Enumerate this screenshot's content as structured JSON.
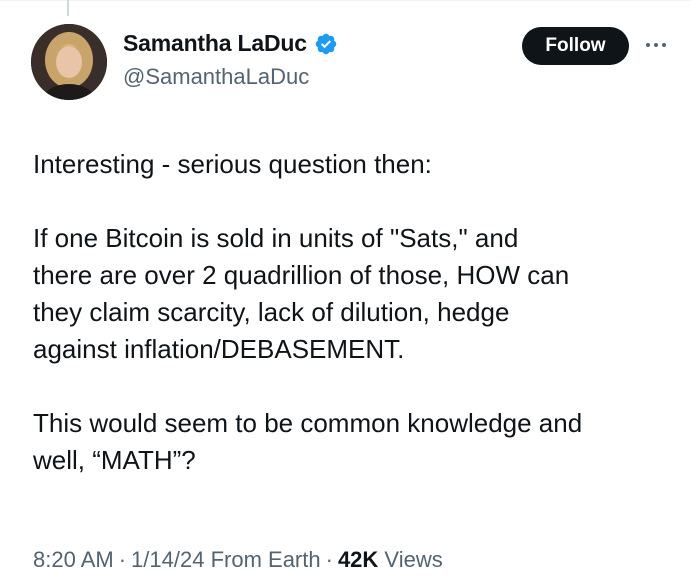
{
  "tweet": {
    "author": {
      "display_name": "Samantha LaDuc",
      "handle": "@SamanthaLaDuc",
      "verified_icon": "verified-badge-icon",
      "verified_color": "#1d9bf0"
    },
    "follow_label": "Follow",
    "more_icon": "more-horizontal-icon",
    "paragraphs": [
      "Interesting - serious question then:",
      "If one Bitcoin is sold in units of \"Sats,\" and\nthere are over 2 quadrillion of those, HOW can\nthey claim scarcity, lack of dilution, hedge\nagainst inflation/DEBASEMENT.",
      "This would seem to be common knowledge and\nwell, “MATH”?"
    ],
    "meta": {
      "time": "8:20 AM",
      "separator": "·",
      "date": "1/14/24",
      "source": "From Earth",
      "views_count": "42K",
      "views_label": "Views"
    },
    "colors": {
      "text": "#0f1419",
      "secondary": "#536471",
      "follow_bg": "#0f1419"
    }
  }
}
